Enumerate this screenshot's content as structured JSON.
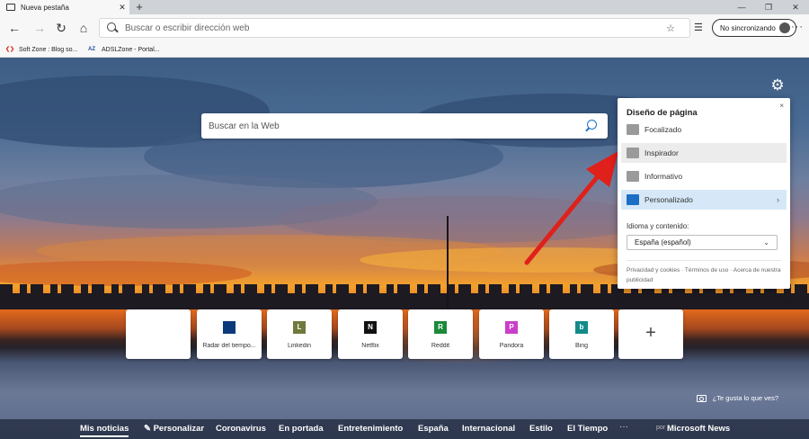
{
  "browser": {
    "tab_title": "Nueva pestaña",
    "new_tab": "+",
    "window_controls": [
      "—",
      "❐",
      "✕"
    ],
    "address_placeholder": "Buscar o escribir dirección web",
    "sync_label": "No sincronizando",
    "more": "···"
  },
  "favorites": [
    {
      "label": "Soft Zone : Blog so...",
      "icon_color": "#d9342b"
    },
    {
      "label": "ADSLZone - Portal...",
      "icon_color": "#1c4d9c",
      "icon_text": "AZ"
    }
  ],
  "page": {
    "search_placeholder": "Buscar en la Web",
    "photo_like": "¿Te gusta lo que ves?"
  },
  "layout_panel": {
    "title": "Diseño de página",
    "options": [
      {
        "label": "Focalizado",
        "state": "normal"
      },
      {
        "label": "Inspirador",
        "state": "hover"
      },
      {
        "label": "Informativo",
        "state": "normal"
      },
      {
        "label": "Personalizado",
        "state": "active",
        "chevron": "›"
      }
    ],
    "language_label": "Idioma y contenido:",
    "language_value": "España (español)",
    "links": "Privacidad y cookies · Términos de uso · Acerca de nuestra publicidad",
    "close": "×"
  },
  "quick_links": [
    {
      "label": "",
      "icon_text": "",
      "icon_color": "#ffffff"
    },
    {
      "label": "Radar del tiempo...",
      "icon_text": "",
      "icon_color": "#0b3a7a"
    },
    {
      "label": "Linkedin",
      "icon_text": "L",
      "icon_color": "#6f7a3c"
    },
    {
      "label": "Netflix",
      "icon_text": "N",
      "icon_color": "#111111"
    },
    {
      "label": "Reddit",
      "icon_text": "R",
      "icon_color": "#1a8a3a"
    },
    {
      "label": "Pandora",
      "icon_text": "P",
      "icon_color": "#c93fc8"
    },
    {
      "label": "Bing",
      "icon_text": "b",
      "icon_color": "#138a8a"
    },
    {
      "label": "",
      "icon_text": "+",
      "icon_color": "#ffffff"
    }
  ],
  "news_bar": {
    "items": [
      "Mis noticias",
      "✎ Personalizar",
      "Coronavirus",
      "En portada",
      "Entretenimiento",
      "España",
      "Internacional",
      "Estilo",
      "El Tiempo"
    ],
    "more": "···",
    "powered_by": "por",
    "brand": "Microsoft News"
  },
  "colors": {
    "accent": "#1c6fc4",
    "arrow": "#e0201b",
    "panel_active": "#d6e8f7"
  }
}
